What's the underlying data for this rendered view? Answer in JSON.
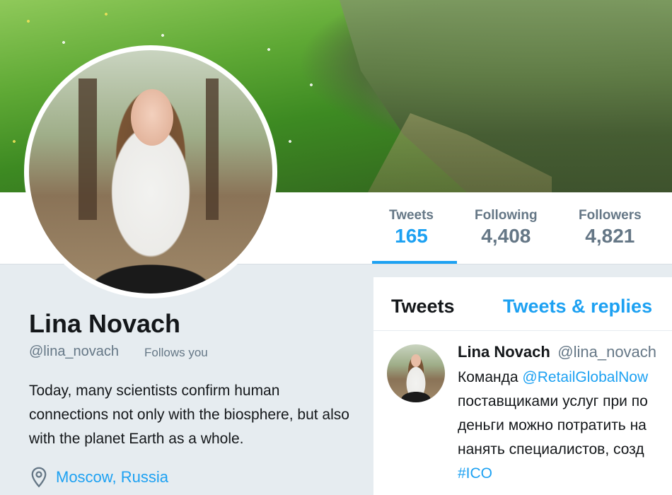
{
  "profile": {
    "name": "Lina Novach",
    "handle": "@lina_novach",
    "follows_you": "Follows you",
    "bio": "Today, many scientists confirm human connections not only with the biosphere, but also with the planet Earth as a whole.",
    "location": "Moscow, Russia"
  },
  "stats": [
    {
      "label": "Tweets",
      "value": "165",
      "active": true
    },
    {
      "label": "Following",
      "value": "4,408",
      "active": false
    },
    {
      "label": "Followers",
      "value": "4,821",
      "active": false
    }
  ],
  "tabs": [
    {
      "label": "Tweets"
    },
    {
      "label": "Tweets & replies"
    }
  ],
  "tweet": {
    "name": "Lina Novach",
    "handle": "@lina_novach",
    "line1_prefix": "Команда ",
    "line1_link": "@RetailGlobalNow",
    "line2": "поставщиками услуг при по",
    "line3": "деньги можно потратить на",
    "line4": "нанять специалистов, созд",
    "hashtag": "#ICO"
  },
  "colors": {
    "accent": "#1da1f2",
    "secondary_text": "#657786",
    "primary_text": "#14171a",
    "background": "#e6ecf0"
  },
  "icons": {
    "location": "map-pin-icon"
  }
}
